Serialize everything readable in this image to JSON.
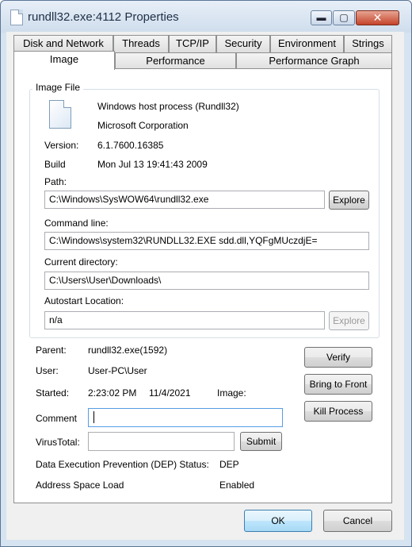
{
  "window": {
    "title": "rundll32.exe:4112 Properties",
    "controls": {
      "minimize": "▬",
      "maximize": "▢",
      "close": "✕"
    }
  },
  "tabs": {
    "row1": [
      "Disk and Network",
      "Threads",
      "TCP/IP",
      "Security",
      "Environment",
      "Strings"
    ],
    "row2": [
      "Image",
      "Performance",
      "Performance Graph"
    ],
    "active": "Image"
  },
  "image_file": {
    "group_label": "Image File",
    "description": "Windows host process (Rundll32)",
    "company": "Microsoft Corporation",
    "version_label": "Version:",
    "version": "6.1.7600.16385",
    "build_label": "Build",
    "build": "Mon Jul 13 19:41:43 2009",
    "path_label": "Path:",
    "path": "C:\\Windows\\SysWOW64\\rundll32.exe",
    "explore_label": "Explore",
    "cmdline_label": "Command line:",
    "cmdline": "C:\\Windows\\system32\\RUNDLL32.EXE  sdd.dll,YQFgMUczdjE=",
    "curdir_label": "Current directory:",
    "curdir": "C:\\Users\\User\\Downloads\\",
    "autostart_label": "Autostart Location:",
    "autostart": "n/a",
    "explore2_label": "Explore"
  },
  "details": {
    "parent_label": "Parent:",
    "parent": "rundll32.exe(1592)",
    "user_label": "User:",
    "user": "User-PC\\User",
    "started_label": "Started:",
    "started_time": "2:23:02 PM",
    "started_date": "11/4/2021",
    "image_label": "Image:",
    "comment_label": "Comment",
    "comment": "",
    "virustotal_label": "VirusTotal:",
    "virustotal": "",
    "submit_label": "Submit",
    "dep_label": "Data Execution Prevention (DEP) Status:",
    "dep_value": "DEP",
    "aslr_label": "Address Space Load",
    "aslr_value": "Enabled"
  },
  "buttons": {
    "verify": "Verify",
    "bring_to_front": "Bring to Front",
    "kill_process": "Kill Process",
    "ok": "OK",
    "cancel": "Cancel"
  }
}
